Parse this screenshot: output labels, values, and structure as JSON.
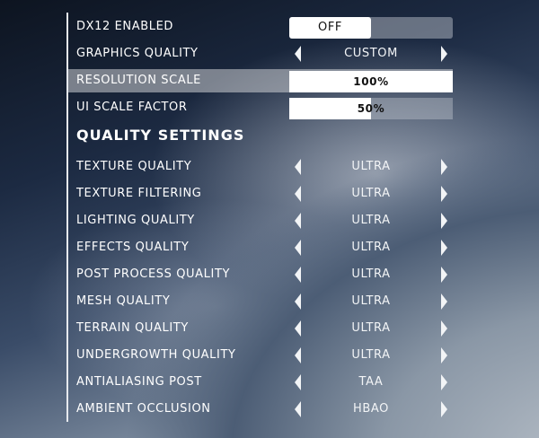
{
  "general": {
    "dx12": {
      "label": "DX12 ENABLED",
      "value": "OFF"
    },
    "graphics_quality": {
      "label": "GRAPHICS QUALITY",
      "value": "CUSTOM"
    },
    "resolution_scale": {
      "label": "RESOLUTION SCALE",
      "value": "100%",
      "level": 1.0
    },
    "ui_scale_factor": {
      "label": "UI SCALE FACTOR",
      "value": "50%",
      "level": 0.5
    }
  },
  "quality_heading": "QUALITY SETTINGS",
  "quality": [
    {
      "label": "TEXTURE QUALITY",
      "value": "ULTRA"
    },
    {
      "label": "TEXTURE FILTERING",
      "value": "ULTRA"
    },
    {
      "label": "LIGHTING QUALITY",
      "value": "ULTRA"
    },
    {
      "label": "EFFECTS QUALITY",
      "value": "ULTRA"
    },
    {
      "label": "POST PROCESS QUALITY",
      "value": "ULTRA"
    },
    {
      "label": "MESH QUALITY",
      "value": "ULTRA"
    },
    {
      "label": "TERRAIN QUALITY",
      "value": "ULTRA"
    },
    {
      "label": "UNDERGROWTH QUALITY",
      "value": "ULTRA"
    },
    {
      "label": "ANTIALIASING POST",
      "value": "TAA"
    },
    {
      "label": "AMBIENT OCCLUSION",
      "value": "HBAO"
    }
  ],
  "icons": {
    "left": "chevron-left-icon",
    "right": "chevron-right-icon"
  }
}
